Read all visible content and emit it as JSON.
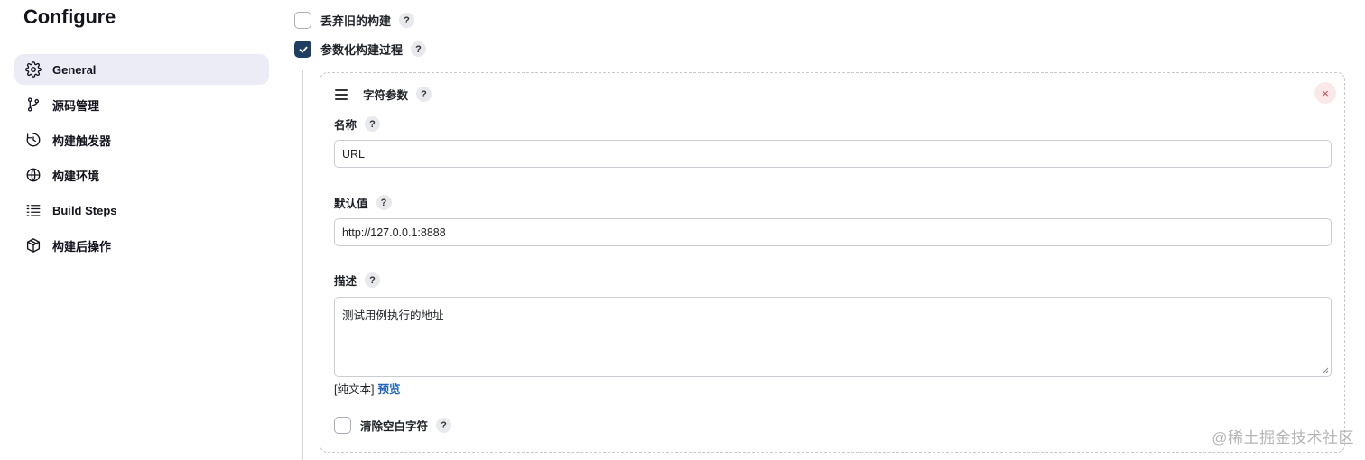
{
  "sidebar": {
    "title": "Configure",
    "items": [
      {
        "label": "General",
        "icon": "gear-icon",
        "active": true
      },
      {
        "label": "源码管理",
        "icon": "branch-icon"
      },
      {
        "label": "构建触发器",
        "icon": "clock-icon"
      },
      {
        "label": "构建环境",
        "icon": "globe-icon"
      },
      {
        "label": "Build Steps",
        "icon": "list-icon"
      },
      {
        "label": "构建后操作",
        "icon": "package-icon"
      }
    ]
  },
  "options": {
    "discard_old_builds": {
      "label": "丢弃旧的构建",
      "checked": false
    },
    "parameterized": {
      "label": "参数化构建过程",
      "checked": true
    }
  },
  "param": {
    "type_label": "字符参数",
    "close_symbol": "×",
    "name_label": "名称",
    "name_value": "URL",
    "default_label": "默认值",
    "default_value": "http://127.0.0.1:8888",
    "desc_label": "描述",
    "desc_value": "测试用例执行的地址",
    "format_text": "[纯文本]",
    "preview_link": "预览",
    "trim_label": "清除空白字符",
    "trim_checked": false
  },
  "help_symbol": "?",
  "watermark": "@稀土掘金技术社区",
  "colors": {
    "active_nav_bg": "#ececf6",
    "checkbox_checked": "#1f3f62",
    "link": "#1f64c4",
    "close_btn": "#d3434b"
  }
}
